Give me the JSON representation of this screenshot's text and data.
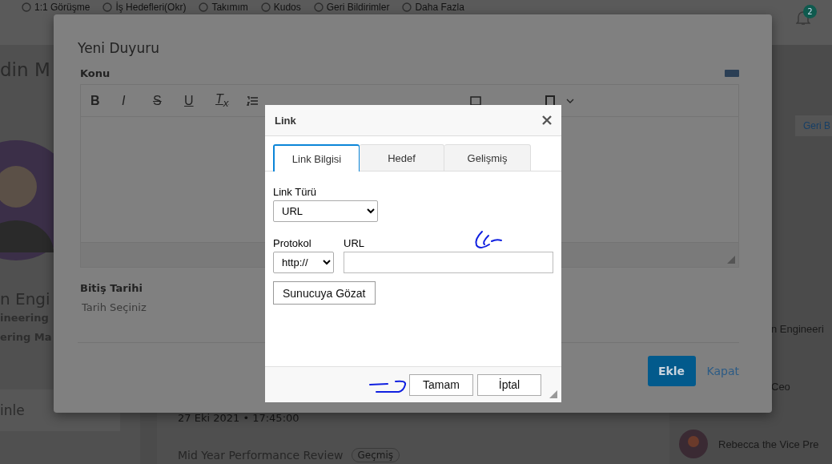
{
  "nav": {
    "items": [
      {
        "label": "1:1 Görüşme"
      },
      {
        "label": "İş Hedefleri(Okr)"
      },
      {
        "label": "Takımım"
      },
      {
        "label": "Kudos"
      },
      {
        "label": "Geri Bildirimler"
      },
      {
        "label": "Daha Fazla"
      }
    ],
    "notification_count": "2"
  },
  "profile": {
    "name": "din M",
    "title": "n Engi",
    "department": "ineering",
    "role": "ering Ma",
    "action": "inle"
  },
  "feed": {
    "date": "27 Eki 2021 • 17:45:00",
    "items": [
      {
        "title": "Mid Year Performance Review",
        "badge": "Geçmiş"
      }
    ]
  },
  "side": {
    "button": "Geri B",
    "people": [
      {
        "name": "n Engineeri",
        "avatar": false
      },
      {
        "name": "Ceo",
        "avatar": false
      },
      {
        "name": "Rebecca the Vice Pre",
        "avatar": true
      }
    ]
  },
  "modal": {
    "title": "Yeni Duyuru",
    "subject_label": "Konu",
    "toolbar": [
      {
        "kind": "bold",
        "label": "B"
      },
      {
        "kind": "italic",
        "label": "I"
      },
      {
        "kind": "strike",
        "label": "S"
      },
      {
        "kind": "underline",
        "label": "U"
      },
      {
        "kind": "clear",
        "label": "T$_{x}$"
      }
    ],
    "date_label": "Bitiş Tarihi",
    "date_placeholder": "Tarih Seçiniz",
    "buttons": {
      "primary": "Ekle",
      "secondary": "Kapat"
    }
  },
  "link_dialog": {
    "title": "Link",
    "tabs": [
      {
        "label": "Link Bilgisi",
        "selected": true
      },
      {
        "label": "Hedef",
        "selected": false
      },
      {
        "label": "Gelişmiş",
        "selected": false
      }
    ],
    "link_type_label": "Link Türü",
    "link_type": "URL",
    "protocol_label": "Protokol",
    "protocol": "http://",
    "url_label": "URL",
    "browse_button": "Sunucuya Gözat",
    "ok_button": "Tamam",
    "cancel_button": "İptal"
  }
}
